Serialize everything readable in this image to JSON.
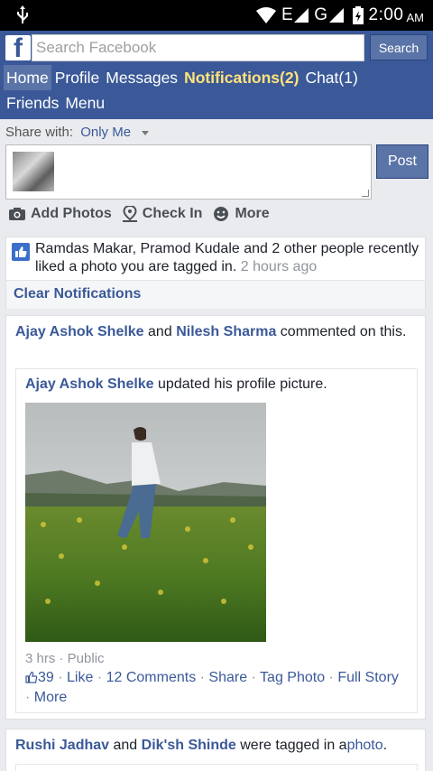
{
  "status_bar": {
    "network": "E",
    "network2": "G",
    "time": "2:00",
    "ampm": "AM"
  },
  "header": {
    "logo_letter": "f",
    "search_placeholder": "Search Facebook",
    "search_button": "Search",
    "nav": {
      "home": "Home",
      "profile": "Profile",
      "messages": "Messages",
      "notifications": "Notifications(2)",
      "chat": "Chat(1)",
      "friends": "Friends",
      "menu": "Menu"
    }
  },
  "composer": {
    "share_with_label": "Share with:",
    "share_with_value": "Only Me",
    "post_button": "Post",
    "actions": {
      "add_photos": "Add Photos",
      "check_in": "Check In",
      "more": "More"
    }
  },
  "notification": {
    "text": "Ramdas Makar, Pramod Kudale and 2 other people recently liked a photo you are tagged in.",
    "time": "2 hours ago",
    "clear": "Clear Notifications"
  },
  "story": {
    "actor1": "Ajay Ashok Shelke",
    "and": "and",
    "actor2": "Nilesh Sharma",
    "action": "commented on this.",
    "inner_actor": "Ajay Ashok Shelke",
    "inner_action": "updated his profile picture.",
    "meta": "3 hrs · Public",
    "likes": "39",
    "like": "Like",
    "comments": "12 Comments",
    "share": "Share",
    "tag_photo": "Tag Photo",
    "full_story": "Full Story",
    "more": "More"
  },
  "story2": {
    "actor1": "Rushi Jadhav",
    "and": "and",
    "actor2": "Dik'sh Shinde",
    "action": "were tagged in a",
    "object": "photo",
    "period": "."
  },
  "colors": {
    "brand": "#3b5998",
    "notification_highlight": "#ffe37a",
    "button": "#5b74a8"
  }
}
